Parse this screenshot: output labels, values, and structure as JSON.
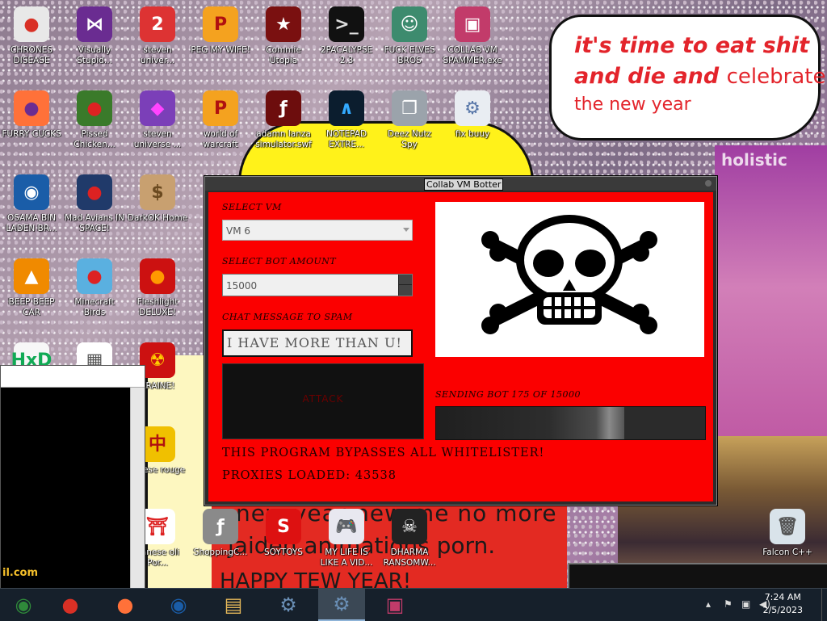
{
  "desktop": {
    "icons": [
      {
        "name": "chrome-icon",
        "label": "CHRONES DISEASE",
        "glyph": "●",
        "bg": "#e8e8e8",
        "color": "#d93025"
      },
      {
        "name": "visual-studio-icon",
        "label": "Visually Stupid...",
        "glyph": "⋈",
        "bg": "#6a2c91",
        "color": "#fff"
      },
      {
        "name": "steven-universe-2-icon",
        "label": "steven univer...",
        "glyph": "2",
        "bg": "#d33",
        "color": "#fff"
      },
      {
        "name": "peg-my-wife-icon",
        "label": "PEG MY WIFE!",
        "glyph": "P",
        "bg": "#f4a21f",
        "color": "#b01010"
      },
      {
        "name": "commie-utopia-icon",
        "label": "Commie Utopia",
        "glyph": "★",
        "bg": "#7a1010",
        "color": "#fff"
      },
      {
        "name": "cmd-icon",
        "label": "2PACALYPSE 2.3",
        "glyph": ">_",
        "bg": "#111",
        "color": "#ddd"
      },
      {
        "name": "elves-icon",
        "label": "FUCK ELVES BROS",
        "glyph": "☺",
        "bg": "#3d8b6e",
        "color": "#fff"
      },
      {
        "name": "collab-spammer-icon",
        "label": "COLLAB VM SPAMMER.exe",
        "glyph": "▣",
        "bg": "#c23b6a",
        "color": "#fff"
      },
      {
        "name": "firefox-icon",
        "label": "FURRY CUCKS",
        "glyph": "●",
        "bg": "#ff7139",
        "color": "#6a2c91"
      },
      {
        "name": "angry-birds-seasons-icon",
        "label": "Pissed Chicken...",
        "glyph": "●",
        "bg": "#3a7a2a",
        "color": "#d22"
      },
      {
        "name": "steven-universe-gem-icon",
        "label": "steven universe ...",
        "glyph": "◆",
        "bg": "#7b3fb8",
        "color": "#f4f"
      },
      {
        "name": "world-of-warcraft-icon",
        "label": "world of warcraft",
        "glyph": "P",
        "bg": "#f4a21f",
        "color": "#b01010"
      },
      {
        "name": "flash-icon",
        "label": "adamn lanza simulator.swf",
        "glyph": "ƒ",
        "bg": "#6d0d0d",
        "color": "#fff"
      },
      {
        "name": "notepad-extreme-icon",
        "label": "NOTEPAD EXTRE...",
        "glyph": "∧",
        "bg": "#0b1d2e",
        "color": "#3af"
      },
      {
        "name": "deez-nutz-icon",
        "label": "Deez Nutz Spy",
        "glyph": "❐",
        "bg": "#9ba3ab",
        "color": "#fff"
      },
      {
        "name": "fix-buuy-icon",
        "label": "fix buuy",
        "glyph": "⚙",
        "bg": "#e9edf2",
        "color": "#5776a8"
      },
      {
        "name": "obama-icon",
        "label": "OSAMA BIN LADEN BR...",
        "glyph": "◉",
        "bg": "#1a5da8",
        "color": "#fff"
      },
      {
        "name": "angry-birds-space-icon",
        "label": "Mad Avians IN SPACE!",
        "glyph": "●",
        "bg": "#203a6a",
        "color": "#d22"
      },
      {
        "name": "darkok-home-icon",
        "label": "DarkOK Home",
        "glyph": "$",
        "bg": "#c8a070",
        "color": "#6b4a20"
      },
      {
        "name": "vlc-icon",
        "label": "BEEP BEEP CAR",
        "glyph": "▲",
        "bg": "#f08a00",
        "color": "#fff"
      },
      {
        "name": "angry-birds-icon",
        "label": "Minecraft Birds",
        "glyph": "●",
        "bg": "#5ab0e0",
        "color": "#d22"
      },
      {
        "name": "fleshlight-icon",
        "label": "Fleshlight DELUXE!",
        "glyph": "●",
        "bg": "#cc1111",
        "color": "#ff9900"
      },
      {
        "name": "hxd-icon",
        "label": "",
        "glyph": "HxD",
        "bg": "#f7f7f7",
        "color": "#1a5"
      },
      {
        "name": "pixel-icon",
        "label": "",
        "glyph": "▦",
        "bg": "#fff",
        "color": "#555"
      },
      {
        "name": "ukraine-icon",
        "label": "KRAINE!",
        "glyph": "☢",
        "bg": "#cc1111",
        "color": "#ffcc00"
      },
      {
        "name": "mahjong-icon",
        "label": "hinese rouge",
        "glyph": "中",
        "bg": "#f0c000",
        "color": "#b01010"
      },
      {
        "name": "japanese-icon",
        "label": "panese oli Por...",
        "glyph": "⛩",
        "bg": "#fff",
        "color": "#d22"
      },
      {
        "name": "shopping-flash-icon",
        "label": "ShoppingC...",
        "glyph": "ƒ",
        "bg": "#8a8a8a",
        "color": "#fff"
      },
      {
        "name": "soytoys-icon",
        "label": "SOYTOYS",
        "glyph": "S",
        "bg": "#dd1111",
        "color": "#fff"
      },
      {
        "name": "gamepad-icon",
        "label": "MY LIFE IS LIKE A VID...",
        "glyph": "🎮",
        "bg": "#e8e8f0",
        "color": "#333"
      },
      {
        "name": "dharma-icon",
        "label": "DHARMA RANSOMW...",
        "glyph": "☠",
        "bg": "#222",
        "color": "#fff"
      },
      {
        "name": "recycle-bin-icon",
        "label": "Falcon C++",
        "glyph": "🗑",
        "bg": "#d9e3ea",
        "color": "#555"
      }
    ]
  },
  "wallpaper": {
    "speech_line1": "it's time to eat shit",
    "speech_line2a": "and die and ",
    "speech_line2b": "celebrate",
    "speech_line3": "the new year",
    "banner_line1": "new year new me no more",
    "banner_line2": "jaiden animations porn.",
    "banner_line3": "HAPPY TEW YEAR!",
    "side_text": "holistic",
    "left_win_text": "il.com"
  },
  "bot_window": {
    "title": "Collab VM Botter",
    "select_vm_label": "SELECT VM",
    "select_vm_value": "VM 6",
    "bot_amount_label": "SELECT BOT AMOUNT",
    "bot_amount_value": "15000",
    "chat_label": "CHAT MESSAGE TO SPAM",
    "chat_value": "I HAVE MORE THAN U!",
    "attack_label": "ATTACK",
    "sending_text": "SENDING BOT 175 OF 15000",
    "progress": 0.7,
    "bypass_text": "THIS PROGRAM BYPASSES ALL WHITELISTER!",
    "proxies_text": "PROXIES LOADED: 43538"
  },
  "taskbar": {
    "items": [
      {
        "name": "taskbar-start-icon",
        "glyph": "◉",
        "active": false
      },
      {
        "name": "taskbar-chrome-icon",
        "glyph": "●",
        "active": false
      },
      {
        "name": "taskbar-firefox-icon",
        "glyph": "●",
        "active": false
      },
      {
        "name": "taskbar-obama-icon",
        "glyph": "◉",
        "active": false
      },
      {
        "name": "taskbar-explorer-icon",
        "glyph": "▤",
        "active": false
      },
      {
        "name": "taskbar-installer-icon",
        "glyph": "⚙",
        "active": false
      },
      {
        "name": "taskbar-installer2-icon",
        "glyph": "⚙",
        "active": true
      },
      {
        "name": "taskbar-spammer-icon",
        "glyph": "▣",
        "active": false
      }
    ],
    "time": "7:24 AM",
    "date": "2/5/2023"
  },
  "colors": {
    "window_red": "#fb0000",
    "taskbar": "#16202b",
    "label_dark": "#1a0000"
  }
}
